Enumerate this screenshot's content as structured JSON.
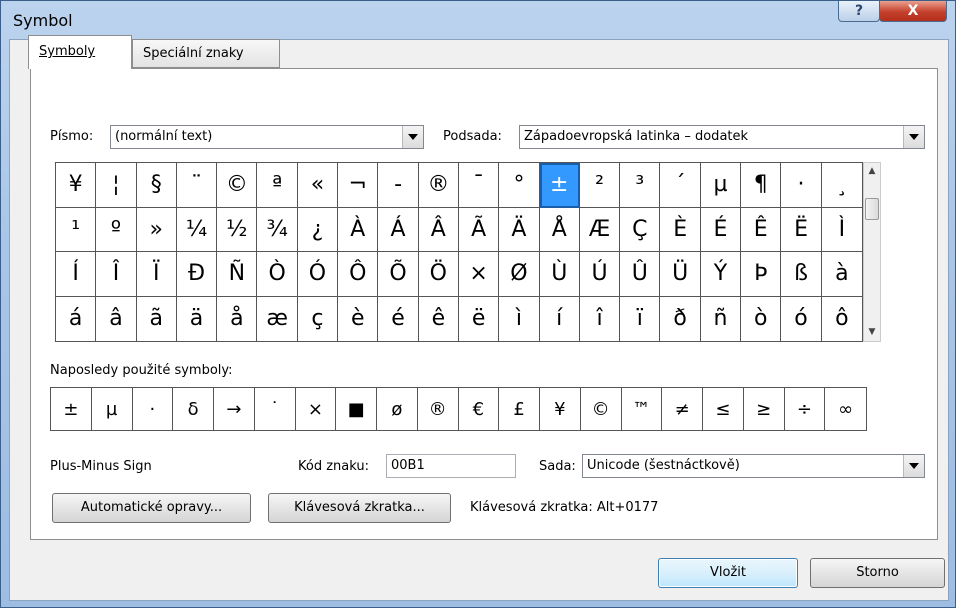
{
  "window": {
    "title": "Symbol",
    "help_label": "?",
    "close_label": "X"
  },
  "tabs": [
    {
      "label": "Symboly",
      "active": true
    },
    {
      "label": "Speciální znaky",
      "active": false
    }
  ],
  "font": {
    "label": "Písmo:",
    "value": "(normální text)"
  },
  "subset": {
    "label": "Podsada:",
    "value": "Západoevropská latinka – dodatek"
  },
  "symbols": [
    "¥",
    "¦",
    "§",
    "¨",
    "©",
    "ª",
    "«",
    "¬",
    "-",
    "®",
    "¯",
    "°",
    "±",
    "²",
    "³",
    "´",
    "µ",
    "¶",
    "·",
    "¸",
    "¹",
    "º",
    "»",
    "¼",
    "½",
    "¾",
    "¿",
    "À",
    "Á",
    "Â",
    "Ã",
    "Ä",
    "Å",
    "Æ",
    "Ç",
    "È",
    "É",
    "Ê",
    "Ë",
    "Ì",
    "Í",
    "Î",
    "Ï",
    "Ð",
    "Ñ",
    "Ò",
    "Ó",
    "Ô",
    "Õ",
    "Ö",
    "×",
    "Ø",
    "Ù",
    "Ú",
    "Û",
    "Ü",
    "Ý",
    "Þ",
    "ß",
    "à",
    "á",
    "â",
    "ã",
    "ä",
    "å",
    "æ",
    "ç",
    "è",
    "é",
    "ê",
    "ë",
    "ì",
    "í",
    "î",
    "ï",
    "ð",
    "ñ",
    "ò",
    "ó",
    "ô"
  ],
  "selected_index": 12,
  "recent": {
    "label": "Naposledy použité symboly:",
    "items": [
      "±",
      "µ",
      "·",
      "δ",
      "→",
      "˙",
      "×",
      "■",
      "ø",
      "®",
      "€",
      "£",
      "¥",
      "©",
      "™",
      "≠",
      "≤",
      "≥",
      "÷",
      "∞"
    ]
  },
  "char_name": "Plus-Minus Sign",
  "char_code": {
    "label": "Kód znaku:",
    "value": "00B1"
  },
  "char_set": {
    "label": "Sada:",
    "value": "Unicode (šestnáctkově)"
  },
  "buttons": {
    "autocorrect": "Automatické opravy...",
    "shortcut_key": "Klávesová zkratka...",
    "insert": "Vložit",
    "cancel": "Storno"
  },
  "shortcut_text": "Klávesová zkratka: Alt+0177"
}
